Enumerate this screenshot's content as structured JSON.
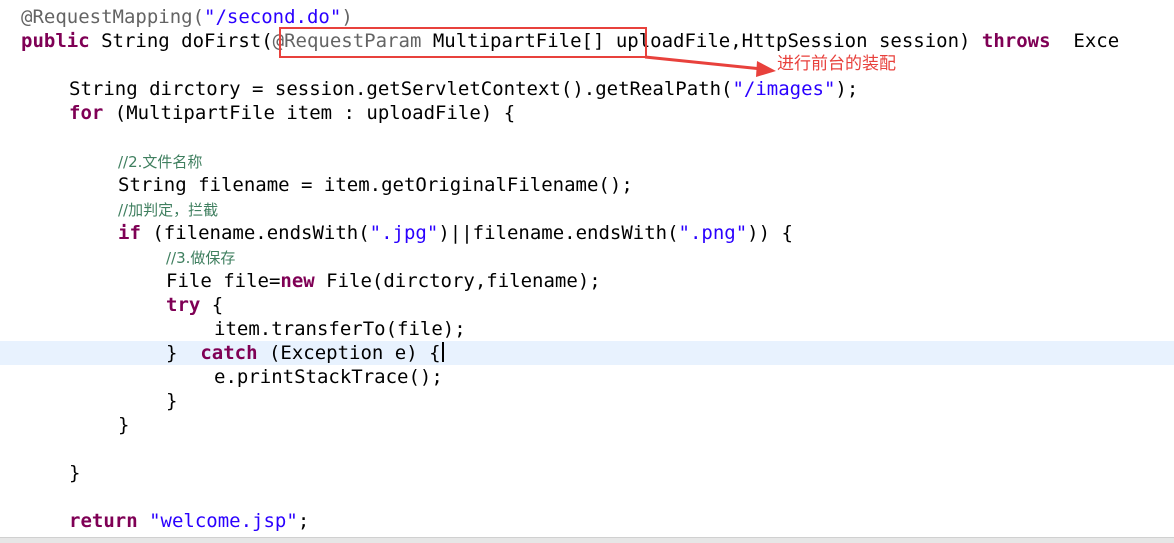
{
  "editor": {
    "lines": [
      {
        "segments": [
          {
            "cls": "ann",
            "text": "@RequestMapping("
          },
          {
            "cls": "str",
            "text": "\"/second.do\""
          },
          {
            "cls": "ann",
            "text": ")"
          }
        ]
      },
      {
        "segments": [
          {
            "cls": "kw",
            "text": "public"
          },
          {
            "cls": "",
            "text": " String doFirst("
          },
          {
            "cls": "ann",
            "text": "@RequestParam"
          },
          {
            "cls": "",
            "text": " MultipartFile[] uploadFile,HttpSession session) "
          },
          {
            "cls": "kw",
            "text": "throws"
          },
          {
            "cls": "",
            "text": "  Exce"
          }
        ]
      },
      {
        "segments": []
      },
      {
        "segments": [
          {
            "cls": "",
            "text": "String dirctory = session.getServletContext().getRealPath("
          },
          {
            "cls": "str",
            "text": "\"/images\""
          },
          {
            "cls": "",
            "text": ");"
          }
        ]
      },
      {
        "segments": [
          {
            "cls": "kw",
            "text": "for"
          },
          {
            "cls": "",
            "text": " (MultipartFile item : uploadFile) {"
          }
        ]
      },
      {
        "segments": []
      },
      {
        "segments": [
          {
            "cls": "cmt",
            "text": "//2.文件名称"
          }
        ]
      },
      {
        "segments": [
          {
            "cls": "",
            "text": "String filename = item.getOriginalFilename();"
          }
        ]
      },
      {
        "segments": [
          {
            "cls": "cmt",
            "text": "//加判定，拦截"
          }
        ]
      },
      {
        "segments": [
          {
            "cls": "kw",
            "text": "if"
          },
          {
            "cls": "",
            "text": " (filename.endsWith("
          },
          {
            "cls": "str",
            "text": "\".jpg\""
          },
          {
            "cls": "",
            "text": ")||filename.endsWith("
          },
          {
            "cls": "str",
            "text": "\".png\""
          },
          {
            "cls": "",
            "text": ")) {"
          }
        ]
      },
      {
        "segments": [
          {
            "cls": "cmt",
            "text": "//3.做保存"
          }
        ]
      },
      {
        "segments": [
          {
            "cls": "",
            "text": "File file="
          },
          {
            "cls": "kw",
            "text": "new"
          },
          {
            "cls": "",
            "text": " File(dirctory,filename);"
          }
        ]
      },
      {
        "segments": [
          {
            "cls": "kw",
            "text": "try"
          },
          {
            "cls": "",
            "text": " {"
          }
        ]
      },
      {
        "segments": [
          {
            "cls": "",
            "text": "item.transferTo(file);"
          }
        ]
      },
      {
        "segments": [
          {
            "cls": "",
            "text": "}  "
          },
          {
            "cls": "kw",
            "text": "catch"
          },
          {
            "cls": "",
            "text": " (Exception e) {"
          }
        ]
      },
      {
        "segments": [
          {
            "cls": "",
            "text": "e.printStackTrace();"
          }
        ]
      },
      {
        "segments": [
          {
            "cls": "",
            "text": "}"
          }
        ]
      },
      {
        "segments": [
          {
            "cls": "",
            "text": "}"
          }
        ]
      },
      {
        "segments": []
      },
      {
        "segments": [
          {
            "cls": "",
            "text": "}"
          }
        ]
      },
      {
        "segments": []
      },
      {
        "segments": [
          {
            "cls": "kw",
            "text": "return"
          },
          {
            "cls": "",
            "text": " "
          },
          {
            "cls": "str",
            "text": "\"welcome.jsp\""
          },
          {
            "cls": "",
            "text": ";"
          }
        ]
      }
    ],
    "current_line": 14
  },
  "annotation": {
    "note": "进行前台的装配",
    "color": "#e8413c"
  },
  "colors": {
    "keyword": "#7f0055",
    "string": "#2a00ff",
    "annotation": "#646464",
    "comment": "#3f7f5f",
    "current_line_bg": "#e8f2fe"
  }
}
